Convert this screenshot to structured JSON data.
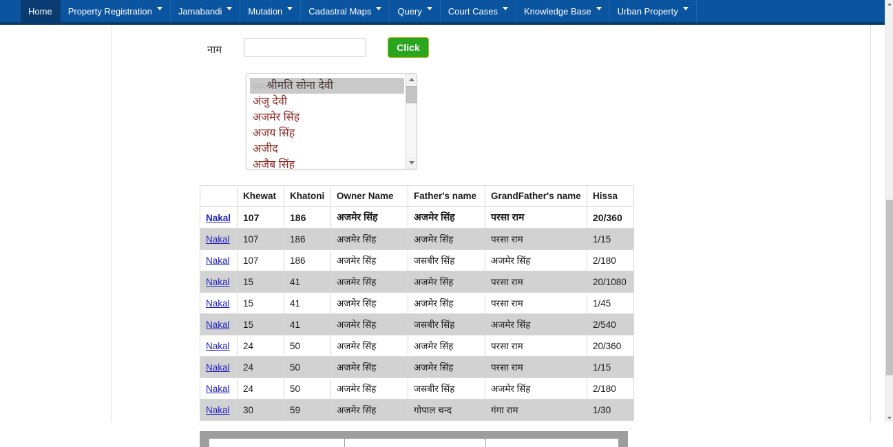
{
  "nav": {
    "items": [
      {
        "label": "Home",
        "has_caret": false,
        "active": true
      },
      {
        "label": "Property Registration",
        "has_caret": true,
        "active": false
      },
      {
        "label": "Jamabandi",
        "has_caret": true,
        "active": false
      },
      {
        "label": "Mutation",
        "has_caret": true,
        "active": false
      },
      {
        "label": "Cadastral Maps",
        "has_caret": true,
        "active": false
      },
      {
        "label": "Query",
        "has_caret": true,
        "active": false
      },
      {
        "label": "Court Cases",
        "has_caret": true,
        "active": false
      },
      {
        "label": "Knowledge Base",
        "has_caret": true,
        "active": false
      },
      {
        "label": "Urban Property",
        "has_caret": true,
        "active": false
      }
    ],
    "bar_color": "#0b549f",
    "active_color": "#0a3c72"
  },
  "search": {
    "name_label": "नाम",
    "name_value": "",
    "name_placeholder": "",
    "button_label": "Click",
    "button_color": "#2aa51e"
  },
  "suggestions": {
    "selected_index": 0,
    "items": [
      {
        "prefix": "◌◌◌",
        "label": "श्रीमति सोना देवी"
      },
      {
        "prefix": "",
        "label": "अंजु देवी"
      },
      {
        "prefix": "",
        "label": "अजमेर सिंह"
      },
      {
        "prefix": "",
        "label": "अजय सिंह"
      },
      {
        "prefix": "",
        "label": "अजीद"
      },
      {
        "prefix": "",
        "label": "अजैब सिंह"
      }
    ]
  },
  "table": {
    "columns": [
      "",
      "Khewat",
      "Khatoni",
      "Owner Name",
      "Father's name",
      "GrandFather's name",
      "Hissa"
    ],
    "action_label": "Nakal",
    "rows": [
      {
        "action": "Nakal",
        "khewat": "107",
        "khatoni": "186",
        "owner": "अजमेर सिंह",
        "father": "अजमेर सिंह",
        "grandfather": "परसा राम",
        "hissa": "20/360"
      },
      {
        "action": "Nakal",
        "khewat": "107",
        "khatoni": "186",
        "owner": "अजमेर सिंह",
        "father": "अजमेर सिंह",
        "grandfather": "परसा राम",
        "hissa": "1/15"
      },
      {
        "action": "Nakal",
        "khewat": "107",
        "khatoni": "186",
        "owner": "अजमेर सिंह",
        "father": "जसबीर सिंह",
        "grandfather": "अजमेर सिंह",
        "hissa": "2/180"
      },
      {
        "action": "Nakal",
        "khewat": "15",
        "khatoni": "41",
        "owner": "अजमेर सिंह",
        "father": "अजमेर सिंह",
        "grandfather": "परसा राम",
        "hissa": "20/1080"
      },
      {
        "action": "Nakal",
        "khewat": "15",
        "khatoni": "41",
        "owner": "अजमेर सिंह",
        "father": "अजमेर सिंह",
        "grandfather": "परसा राम",
        "hissa": "1/45"
      },
      {
        "action": "Nakal",
        "khewat": "15",
        "khatoni": "41",
        "owner": "अजमेर सिंह",
        "father": "जसबीर सिंह",
        "grandfather": "अजमेर सिंह",
        "hissa": "2/540"
      },
      {
        "action": "Nakal",
        "khewat": "24",
        "khatoni": "50",
        "owner": "अजमेर सिंह",
        "father": "अजमेर सिंह",
        "grandfather": "परसा राम",
        "hissa": "20/360"
      },
      {
        "action": "Nakal",
        "khewat": "24",
        "khatoni": "50",
        "owner": "अजमेर सिंह",
        "father": "अजमेर सिंह",
        "grandfather": "परसा राम",
        "hissa": "1/15"
      },
      {
        "action": "Nakal",
        "khewat": "24",
        "khatoni": "50",
        "owner": "अजमेर सिंह",
        "father": "जसबीर सिंह",
        "grandfather": "अजमेर सिंह",
        "hissa": "2/180"
      },
      {
        "action": "Nakal",
        "khewat": "30",
        "khatoni": "59",
        "owner": "अजमेर सिंह",
        "father": "गोपाल चन्द",
        "grandfather": "गंगा राम",
        "hissa": "1/30"
      }
    ]
  }
}
